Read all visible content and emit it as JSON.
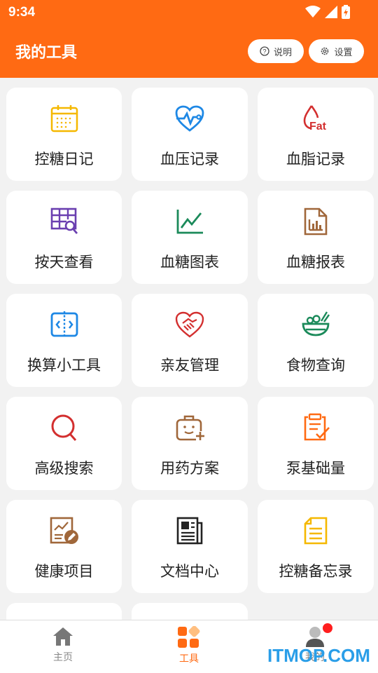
{
  "status_bar": {
    "time": "9:34"
  },
  "header": {
    "title": "我的工具",
    "help_label": "说明",
    "settings_label": "设置",
    "color": "#ff6a13"
  },
  "tools": [
    {
      "label": "控糖日记",
      "icon": "calendar-icon",
      "color": "#f5b800"
    },
    {
      "label": "血压记录",
      "icon": "heart-pulse-icon",
      "color": "#1e88e5"
    },
    {
      "label": "血脂记录",
      "icon": "fat-drop-icon",
      "color": "#d32f2f"
    },
    {
      "label": "按天查看",
      "icon": "grid-search-icon",
      "color": "#6a3fb0"
    },
    {
      "label": "血糖图表",
      "icon": "line-chart-icon",
      "color": "#1b8a5a"
    },
    {
      "label": "血糖报表",
      "icon": "report-file-icon",
      "color": "#a0673a"
    },
    {
      "label": "换算小工具",
      "icon": "convert-icon",
      "color": "#1e88e5"
    },
    {
      "label": "亲友管理",
      "icon": "handshake-heart-icon",
      "color": "#d32f2f"
    },
    {
      "label": "食物查询",
      "icon": "food-bowl-icon",
      "color": "#1b8a5a"
    },
    {
      "label": "高级搜索",
      "icon": "search-icon",
      "color": "#d32f2f"
    },
    {
      "label": "用药方案",
      "icon": "medicine-kit-icon",
      "color": "#a0673a"
    },
    {
      "label": "泵基础量",
      "icon": "clipboard-check-icon",
      "color": "#ff6a13"
    },
    {
      "label": "健康项目",
      "icon": "health-project-icon",
      "color": "#a0673a"
    },
    {
      "label": "文档中心",
      "icon": "newspaper-icon",
      "color": "#222222"
    },
    {
      "label": "控糖备忘录",
      "icon": "memo-icon",
      "color": "#f5b800"
    }
  ],
  "bottom_nav": [
    {
      "label": "主页",
      "icon": "home-icon"
    },
    {
      "label": "工具",
      "icon": "tools-icon",
      "active": true
    },
    {
      "label": "我的",
      "icon": "person-icon"
    }
  ],
  "watermark": "ITMOP.COM"
}
